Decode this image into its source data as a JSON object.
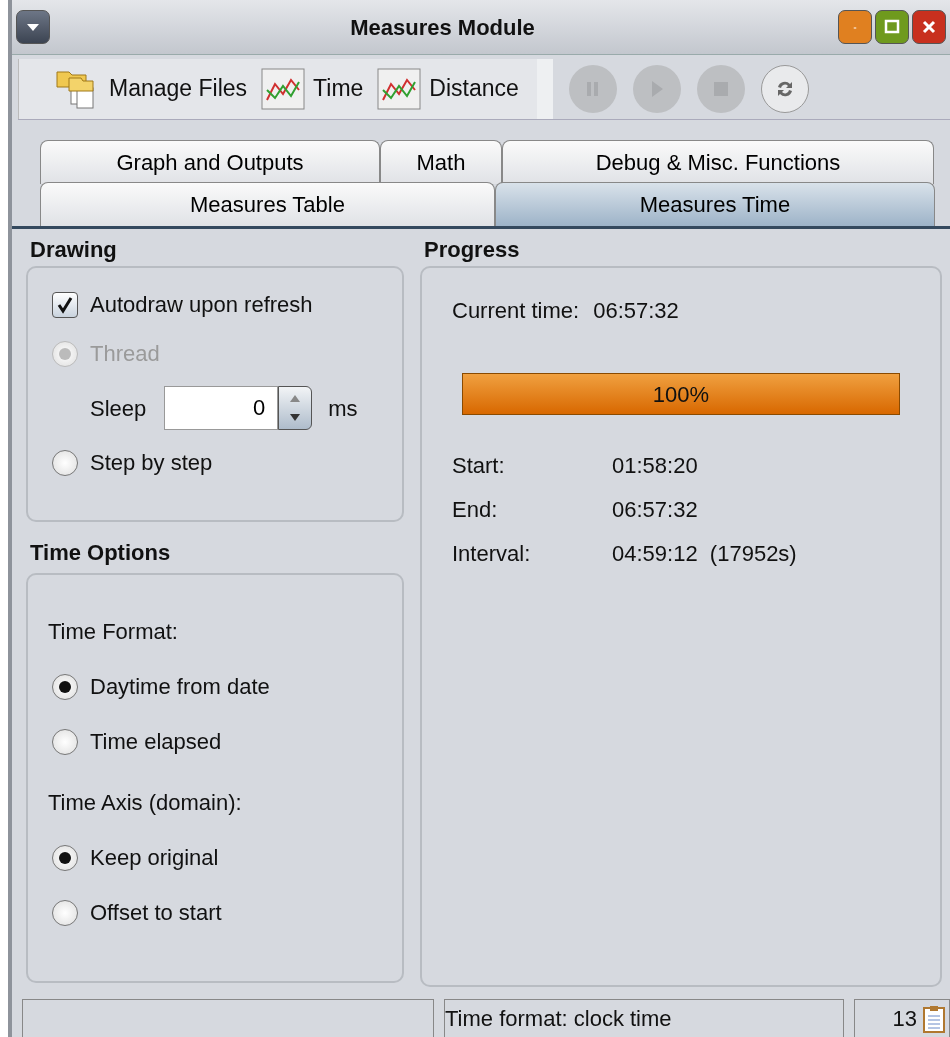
{
  "window": {
    "title": "Measures Module"
  },
  "toolbar": {
    "buttons": [
      {
        "kind": "folder",
        "label": "Manage Files"
      },
      {
        "kind": "chart",
        "label": "Time"
      },
      {
        "kind": "chart",
        "label": "Distance"
      }
    ],
    "controls": [
      {
        "kind": "pause",
        "disabled": true
      },
      {
        "kind": "play",
        "disabled": true
      },
      {
        "kind": "stop",
        "disabled": true
      },
      {
        "kind": "refresh",
        "disabled": false
      }
    ]
  },
  "tab_rows": [
    [
      {
        "label": "Graph and Outputs",
        "selected": false
      },
      {
        "label": "Math",
        "selected": false
      },
      {
        "label": "Debug & Misc. Functions",
        "selected": false
      }
    ],
    [
      {
        "label": "Measures Table",
        "selected": false
      },
      {
        "label": "Measures Time",
        "selected": true
      }
    ]
  ],
  "drawing": {
    "title": "Drawing",
    "autodraw": {
      "label": "Autodraw upon refresh",
      "checked": true
    },
    "thread": {
      "label": "Thread",
      "selected": true,
      "disabled": true
    },
    "sleep": {
      "label": "Sleep",
      "value": "0",
      "unit": "ms"
    },
    "step": {
      "label": "Step by step",
      "selected": false
    }
  },
  "time_options": {
    "title": "Time Options",
    "groups": [
      {
        "label": "Time Format:",
        "options": [
          {
            "label": "Daytime from date",
            "selected": true
          },
          {
            "label": "Time elapsed",
            "selected": false
          }
        ]
      },
      {
        "label": "Time Axis (domain):",
        "options": [
          {
            "label": "Keep original",
            "selected": true
          },
          {
            "label": "Offset to start",
            "selected": false
          }
        ]
      }
    ]
  },
  "progress": {
    "title": "Progress",
    "current_label": "Current time:",
    "current_value": "06:57:32",
    "bar": {
      "level": 1,
      "reading": "100%"
    },
    "rows": [
      {
        "label": "Start:",
        "value": "01:58:20"
      },
      {
        "label": "End:",
        "value": "06:57:32"
      },
      {
        "label": "Interval:",
        "value": "04:59:12  (17952s)"
      }
    ]
  },
  "status_bar": {
    "message": "Time format: clock time",
    "count": "13"
  }
}
